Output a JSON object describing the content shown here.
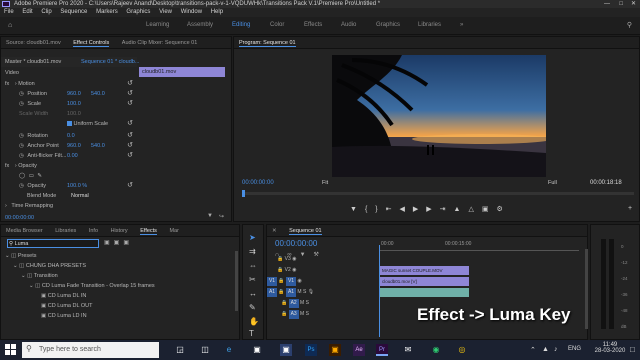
{
  "window": {
    "title": "Adobe Premiere Pro 2020 - C:\\Users\\Rajeev Anand\\Desktop\\transitions-pack-v-1-VQDUWHk\\Transitions Pack V.1\\Premiere Pro\\Untitled *"
  },
  "menu": [
    "File",
    "Edit",
    "Clip",
    "Sequence",
    "Markers",
    "Graphics",
    "View",
    "Window",
    "Help"
  ],
  "workspaces": [
    "Learning",
    "Assembly",
    "Editing",
    "Color",
    "Effects",
    "Audio",
    "Graphics",
    "Libraries",
    "»"
  ],
  "workspace_active": "Editing",
  "source_panel": {
    "tabs": [
      "Source: cloudb01.mov",
      "Effect Controls",
      "Audio Clip Mixer: Sequence 01"
    ],
    "active_tab": "Effect Controls",
    "header_left": "Master * cloudb01.mov",
    "header_right": "Sequence 01 * cloudb...",
    "clip_label": "cloudb01.mov",
    "section_video": "Video",
    "motion": "Motion",
    "position": {
      "label": "Position",
      "x": "960.0",
      "y": "540.0"
    },
    "scale": {
      "label": "Scale",
      "value": "100.0"
    },
    "scale_width": {
      "label": "Scale Width",
      "value": "100.0"
    },
    "uniform": "Uniform Scale",
    "rotation": {
      "label": "Rotation",
      "value": "0.0"
    },
    "anchor": {
      "label": "Anchor Point",
      "x": "960.0",
      "y": "540.0"
    },
    "flicker": {
      "label": "Anti-flicker Filt...",
      "value": "0.00"
    },
    "opacity_section": "Opacity",
    "opacity": {
      "label": "Opacity",
      "value": "100.0 %"
    },
    "blend": {
      "label": "Blend Mode",
      "value": "Normal"
    },
    "time_remap": "Time Remapping",
    "timecode": "00:00:00:00"
  },
  "program_panel": {
    "title": "Program: Sequence 01",
    "timecode_left": "00:00:00:00",
    "fit": "Fit",
    "full": "Full",
    "timecode_right": "00:00:18:18"
  },
  "project_panel": {
    "tabs": [
      "Media Browser",
      "Libraries",
      "Info",
      "History",
      "Effects",
      "Mar"
    ],
    "active_tab": "Effects",
    "search_value": "Luma",
    "tree": [
      "Presets",
      "CHUNG DHA PRESETS",
      "Transition",
      "CD Luma Fade Transition - Overlap 15 frames",
      "CD Luma DL IN",
      "CD Luma DL OUT",
      "CD Luma LD IN"
    ]
  },
  "timeline": {
    "title": "Sequence 01",
    "timecode": "00:00:00:00",
    "ruler_left": "00:00",
    "ruler_mid": "00:00:15:00",
    "tracks": [
      {
        "name": "V3",
        "type": "video"
      },
      {
        "name": "V2",
        "type": "video"
      },
      {
        "name": "V1",
        "type": "video"
      },
      {
        "name": "A1",
        "type": "audio"
      },
      {
        "name": "A2",
        "type": "audio"
      },
      {
        "name": "A3",
        "type": "audio"
      }
    ],
    "clips": [
      "MAGIC sunset COUPLE.MOV",
      "cloudb01.mov [V]"
    ],
    "meter_scale": [
      "0",
      "-12",
      "-24",
      "-36",
      "-48",
      "dB"
    ]
  },
  "overlay_caption": "Effect -> Luma Key",
  "taskbar": {
    "search_placeholder": "Type here to search",
    "time": "11:49",
    "date": "28-03-2020",
    "lang": "ENG"
  },
  "colors": {
    "accent": "#4a8fe3",
    "clip_video": "#8e86d6",
    "clip_audio": "#6fb0a8",
    "taskbar": "#1b2130"
  }
}
